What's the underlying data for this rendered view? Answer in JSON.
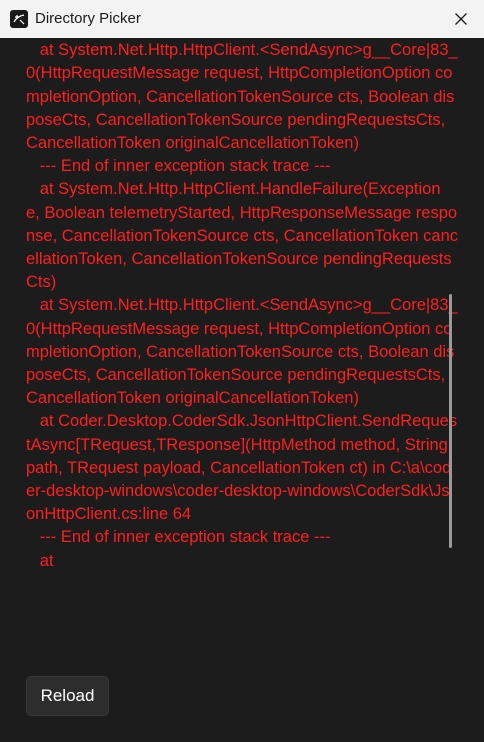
{
  "window": {
    "title": "Directory Picker",
    "app_icon": "coder-logo-icon",
    "close_icon": "close-icon"
  },
  "error": {
    "lines": [
      "cancellationToken)",
      "   at System.Net.Http.HttpClient.<SendAsync>g__Core|83_0(HttpRequestMessage request, HttpCompletionOption completionOption, CancellationTokenSource cts, Boolean disposeCts, CancellationTokenSource pendingRequestsCts, CancellationToken originalCancellationToken)",
      "   --- End of inner exception stack trace ---",
      "   at System.Net.Http.HttpClient.HandleFailure(Exception e, Boolean telemetryStarted, HttpResponseMessage response, CancellationTokenSource cts, CancellationToken cancellationToken, CancellationTokenSource pendingRequestsCts)",
      "   at System.Net.Http.HttpClient.<SendAsync>g__Core|83_0(HttpRequestMessage request, HttpCompletionOption completionOption, CancellationTokenSource cts, Boolean disposeCts, CancellationTokenSource pendingRequestsCts, CancellationToken originalCancellationToken)",
      "   at Coder.Desktop.CoderSdk.JsonHttpClient.SendRequestAsync[TRequest,TResponse](HttpMethod method, String path, TRequest payload, CancellationToken ct) in C:\\a\\coder-desktop-windows\\coder-desktop-windows\\CoderSdk\\JsonHttpClient.cs:line 64",
      "   --- End of inner exception stack trace ---",
      "   at"
    ],
    "color": "#ff1f1f"
  },
  "actions": {
    "reload_label": "Reload"
  }
}
